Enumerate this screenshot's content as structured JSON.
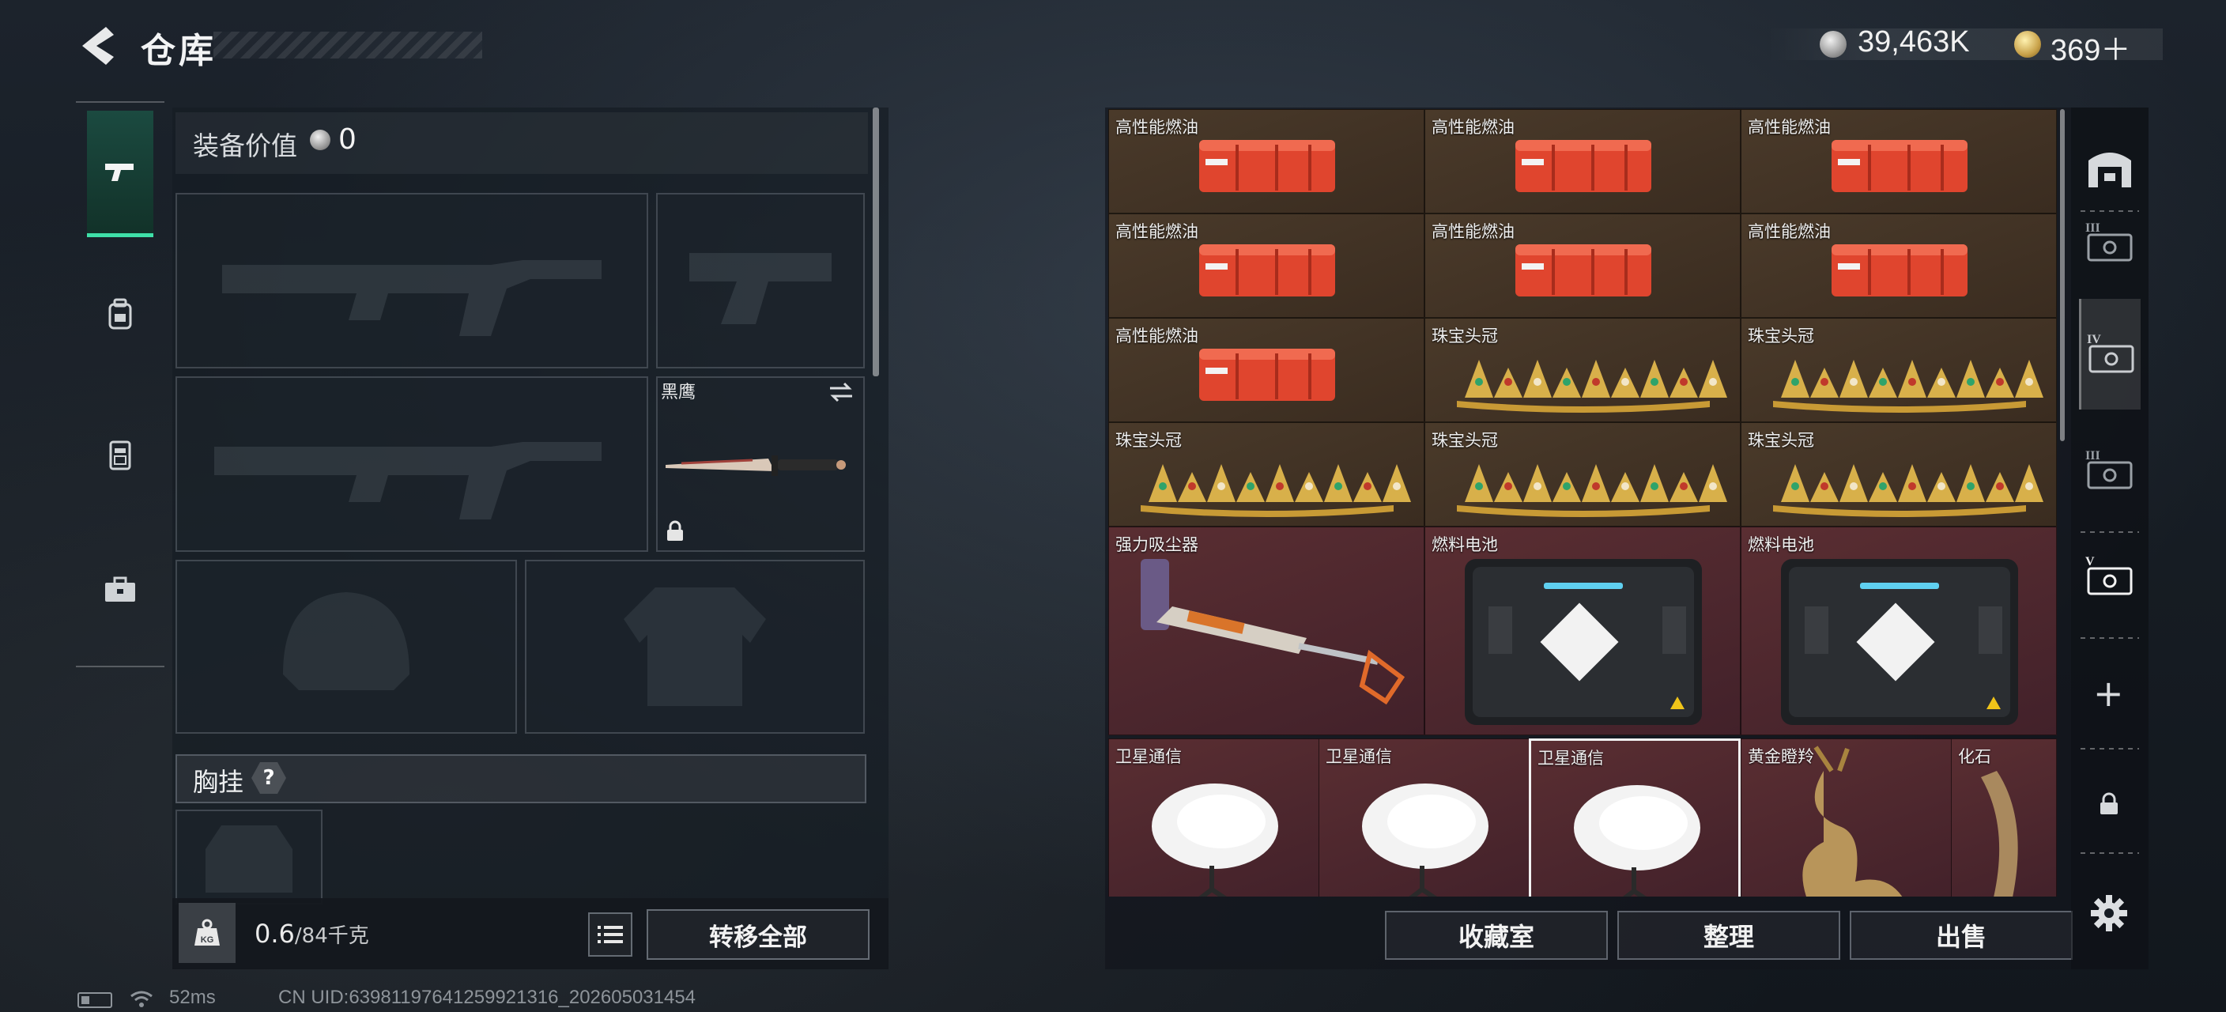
{
  "header": {
    "title": "仓库",
    "currency_silver": "39,463K",
    "currency_gold": "369＋"
  },
  "left_rail": {
    "tabs": [
      {
        "name": "pistol-icon",
        "active": true
      },
      {
        "name": "backpack-icon",
        "active": false
      },
      {
        "name": "vest-icon",
        "active": false
      },
      {
        "name": "toolbox-icon",
        "active": false
      }
    ]
  },
  "loadout": {
    "value_label": "装备价值",
    "value": "0",
    "knife_name": "黑鹰",
    "chest_label": "胸挂",
    "chest_help": "?",
    "weight_current": "0.6",
    "weight_max": "/84千克",
    "transfer_all": "转移全部"
  },
  "storage": {
    "items": [
      {
        "label": "高性能燃油",
        "kind": "fuel"
      },
      {
        "label": "高性能燃油",
        "kind": "fuel"
      },
      {
        "label": "高性能燃油",
        "kind": "fuel"
      },
      {
        "label": "高性能燃油",
        "kind": "fuel"
      },
      {
        "label": "高性能燃油",
        "kind": "fuel"
      },
      {
        "label": "高性能燃油",
        "kind": "fuel"
      },
      {
        "label": "高性能燃油",
        "kind": "fuel"
      },
      {
        "label": "珠宝头冠",
        "kind": "tiara"
      },
      {
        "label": "珠宝头冠",
        "kind": "tiara"
      },
      {
        "label": "珠宝头冠",
        "kind": "tiara"
      },
      {
        "label": "珠宝头冠",
        "kind": "tiara"
      },
      {
        "label": "珠宝头冠",
        "kind": "tiara"
      },
      {
        "label": "强力吸尘器",
        "kind": "vacuum"
      },
      {
        "label": "燃料电池",
        "kind": "battery"
      },
      {
        "label": "燃料电池",
        "kind": "battery"
      },
      {
        "label": "卫星通信",
        "kind": "satellite"
      },
      {
        "label": "卫星通信",
        "kind": "satellite"
      },
      {
        "label": "卫星通信",
        "kind": "satellite",
        "selected": true
      },
      {
        "label": "黄金瞪羚",
        "kind": "gazelle"
      },
      {
        "label": "化石",
        "kind": "fossil"
      }
    ],
    "buttons": {
      "collection": "收藏室",
      "organize": "整理",
      "sell": "出售"
    }
  },
  "right_rail": {
    "items": [
      "depot-icon",
      "case-iii-icon",
      "case-iv-icon",
      "case-iii-b-icon",
      "case-v-icon"
    ],
    "add": "+",
    "colors": {
      "accent": "#3fe0a8",
      "orange_cell": "#3a2c20",
      "red_cell": "#42212a"
    }
  },
  "status_bar": {
    "ping": "52ms",
    "uid": "CN UID:639811976412599213​16_202605031454"
  }
}
